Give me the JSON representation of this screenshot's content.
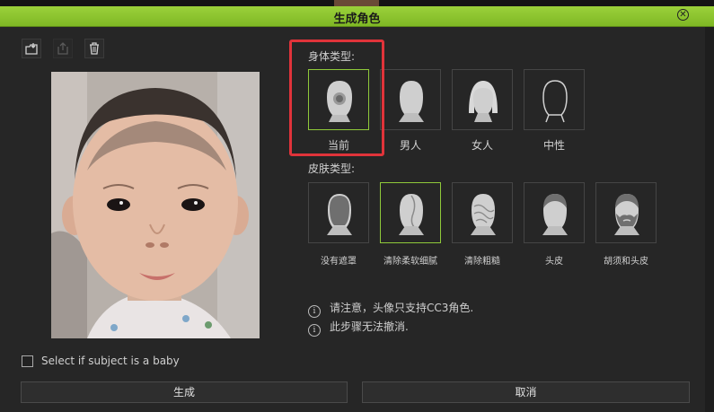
{
  "window": {
    "title": "生成角色",
    "close_icon": "close-circle-icon"
  },
  "toolbar": {
    "icons": [
      "import-icon",
      "export-icon",
      "trash-icon"
    ]
  },
  "photo": {
    "description_icon": "face-photo"
  },
  "body_type": {
    "label": "身体类型:",
    "options": [
      {
        "label": "当前",
        "icon": "current-head-icon",
        "selected": true
      },
      {
        "label": "男人",
        "icon": "male-head-icon",
        "selected": false
      },
      {
        "label": "女人",
        "icon": "female-head-icon",
        "selected": false
      },
      {
        "label": "中性",
        "icon": "neutral-head-icon",
        "selected": false
      }
    ]
  },
  "skin_type": {
    "label": "皮肤类型:",
    "options": [
      {
        "label": "没有遮罩",
        "icon": "no-mask-head-icon",
        "selected": false
      },
      {
        "label": "清除柔软细腻",
        "icon": "smooth-skin-head-icon",
        "selected": true
      },
      {
        "label": "清除粗糙",
        "icon": "rough-skin-head-icon",
        "selected": false
      },
      {
        "label": "头皮",
        "icon": "scalp-head-icon",
        "selected": false
      },
      {
        "label": "胡须和头皮",
        "icon": "beard-scalp-head-icon",
        "selected": false
      }
    ]
  },
  "notes": [
    "请注意，头像只支持CC3角色.",
    "此步骤无法撤消."
  ],
  "baby_checkbox": {
    "label": "Select if subject is a baby",
    "checked": false
  },
  "buttons": {
    "generate": "生成",
    "cancel": "取消"
  },
  "colors": {
    "accent": "#8fc93a",
    "highlight": "#e0333a"
  }
}
